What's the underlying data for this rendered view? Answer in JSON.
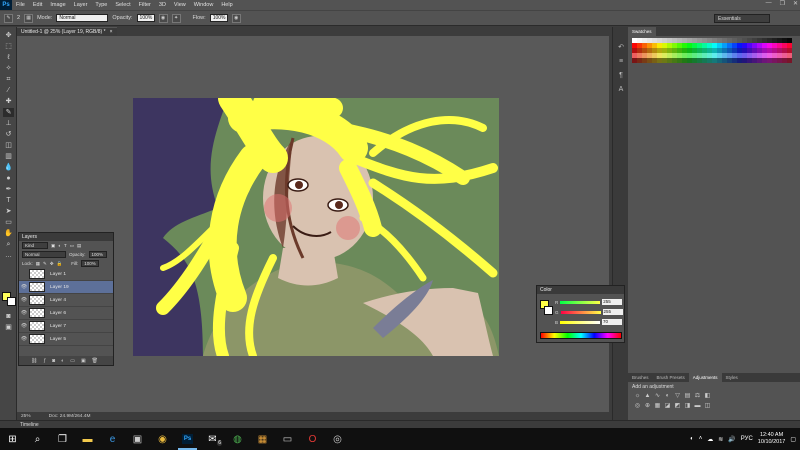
{
  "app": {
    "logo": "Ps"
  },
  "menu": [
    "File",
    "Edit",
    "Image",
    "Layer",
    "Type",
    "Select",
    "Filter",
    "3D",
    "View",
    "Window",
    "Help"
  ],
  "window_controls": {
    "minimize": "—",
    "maximize": "❐",
    "close": "✕"
  },
  "options": {
    "brush_size": "2",
    "mode_label": "Mode:",
    "mode_value": "Normal",
    "opacity_label": "Opacity:",
    "opacity_value": "100%",
    "flow_label": "Flow:",
    "flow_value": "100%",
    "workspace": "Essentials"
  },
  "document": {
    "tab_title": "Untitled-1 @ 25% (Layer 19, RGB/8) *",
    "close_glyph": "×"
  },
  "panels": {
    "swatches_tab": "Swatches",
    "adjust_tabs": [
      "Brushes",
      "Brush Presets",
      "Adjustments",
      "Styles"
    ],
    "adjustments_title": "Add an adjustment"
  },
  "layers_panel": {
    "title": "Layers",
    "kind_label": "Kind",
    "blend_mode": "Normal",
    "opacity_label": "Opacity:",
    "opacity_value": "100%",
    "lock_label": "Lock:",
    "fill_label": "Fill:",
    "fill_value": "100%",
    "layers": [
      {
        "name": "Layer 1",
        "visible": false,
        "selected": false
      },
      {
        "name": "Layer 19",
        "visible": true,
        "selected": true
      },
      {
        "name": "Layer 4",
        "visible": true,
        "selected": false
      },
      {
        "name": "Layer 6",
        "visible": true,
        "selected": false
      },
      {
        "name": "Layer 7",
        "visible": true,
        "selected": false
      },
      {
        "name": "Layer 5",
        "visible": true,
        "selected": false
      }
    ]
  },
  "color_panel": {
    "title": "Color",
    "r_label": "R",
    "r": "255",
    "g_label": "G",
    "g": "255",
    "b_label": "B",
    "b": "70",
    "foreground": "#ffff46"
  },
  "status": {
    "zoom": "25%",
    "doc_size": "Doc: 24.9M/264.4M"
  },
  "timeline": {
    "label": "Timeline"
  },
  "taskbar": {
    "time": "12:40 AM",
    "date": "10/10/2017",
    "lang": "РУС",
    "badge": "6"
  },
  "colors": {
    "canvas_bg": "#6b8a5a",
    "hair": "#ffff46",
    "dark_purple": "#3d3560",
    "skin": "#d9c2b0",
    "shirt": "#8c9668"
  }
}
